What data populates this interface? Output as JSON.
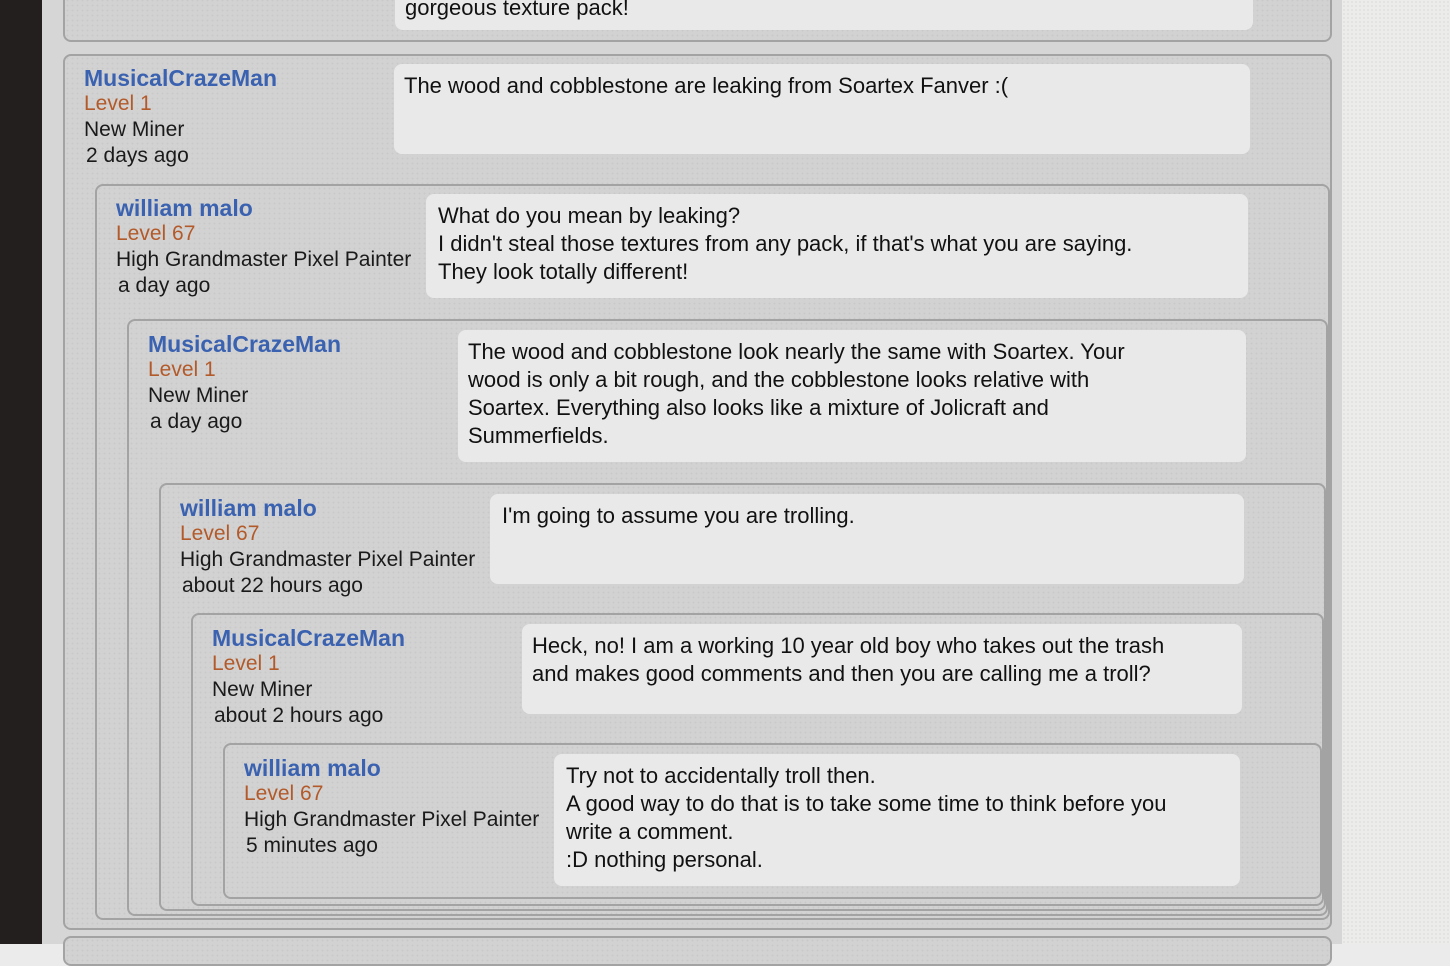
{
  "previous_comment": {
    "text": "gorgeous texture pack!"
  },
  "comments": [
    {
      "author": "MusicalCrazeMan",
      "level": "Level 1",
      "rank": "New Miner",
      "time": "2 days ago",
      "lines": [
        "The wood and cobblestone are leaking from Soartex Fanver :("
      ]
    },
    {
      "author": "william malo",
      "level": "Level 67",
      "rank": "High Grandmaster Pixel Painter",
      "time": "a day ago",
      "lines": [
        "What do you mean by leaking?",
        "I didn't steal those textures from any pack, if that's what you are saying.",
        "They look totally different!"
      ]
    },
    {
      "author": "MusicalCrazeMan",
      "level": "Level 1",
      "rank": "New Miner",
      "time": "a day ago",
      "lines": [
        "The wood and cobblestone look nearly the same with Soartex. Your",
        "wood is only a bit rough, and the cobblestone looks relative with",
        "Soartex. Everything also looks like a mixture of Jolicraft and",
        "Summerfields."
      ]
    },
    {
      "author": "william malo",
      "level": "Level 67",
      "rank": "High Grandmaster Pixel Painter",
      "time": "about 22 hours ago",
      "lines": [
        "I'm going to assume you are trolling."
      ]
    },
    {
      "author": "MusicalCrazeMan",
      "level": "Level 1",
      "rank": "New Miner",
      "time": "about 2 hours ago",
      "lines": [
        "Heck, no! I am a working 10 year old boy who takes out the trash",
        "and makes good comments and then you are calling me a troll?"
      ]
    },
    {
      "author": "william malo",
      "level": "Level 67",
      "rank": "High Grandmaster Pixel Painter",
      "time": "5 minutes ago",
      "lines": [
        "Try not to accidentally troll then.",
        "A good way to do that is to take some time to think before you",
        "write a comment.",
        ":D nothing personal."
      ]
    }
  ]
}
